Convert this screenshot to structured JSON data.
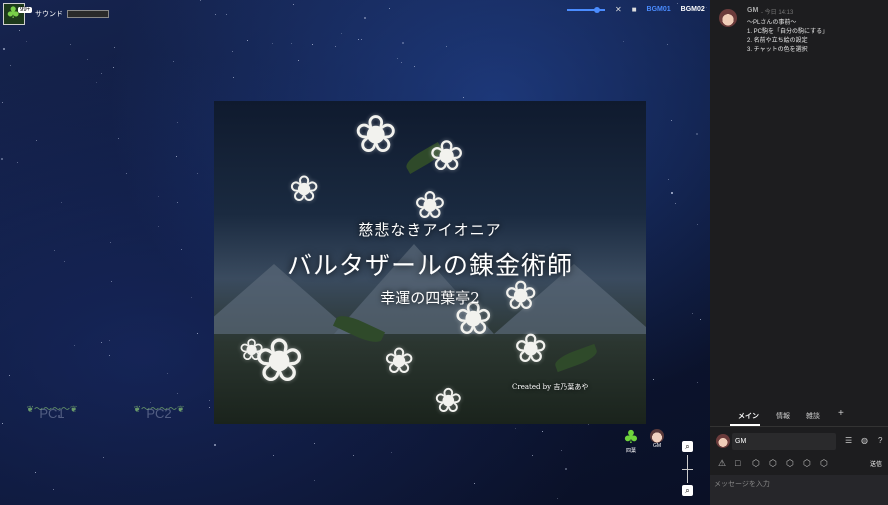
{
  "toolbar": {
    "badge": "99+",
    "sound_label": "サウンド",
    "bgm1": "BGM01",
    "bgm2": "BGM02",
    "volume_level": 0.8
  },
  "title_card": {
    "subtitle_top": "慈悲なきアイオニア",
    "title": "バルタザールの錬金術師",
    "subtitle_bottom": "幸運の四葉亭2",
    "credit": "Created by 吉乃葉あや"
  },
  "board": {
    "pc1_label": "PC1",
    "pc2_label": "PC2",
    "piece_clover_label": "四葉",
    "piece_gm_label": "GM"
  },
  "chat": {
    "message": {
      "name": "GM",
      "time": "- 今日 14:13",
      "lines": [
        "〜PLさんの事前〜",
        "1. PC駒を「自分の駒にする」",
        "2. 名前や立ち絵の設定",
        "3. チャットの色を選択"
      ]
    },
    "tabs": [
      "メイン",
      "情報",
      "雑談",
      "+"
    ],
    "sender_name": "GM",
    "send_label": "送信",
    "input_placeholder": "メッセージを入力"
  }
}
